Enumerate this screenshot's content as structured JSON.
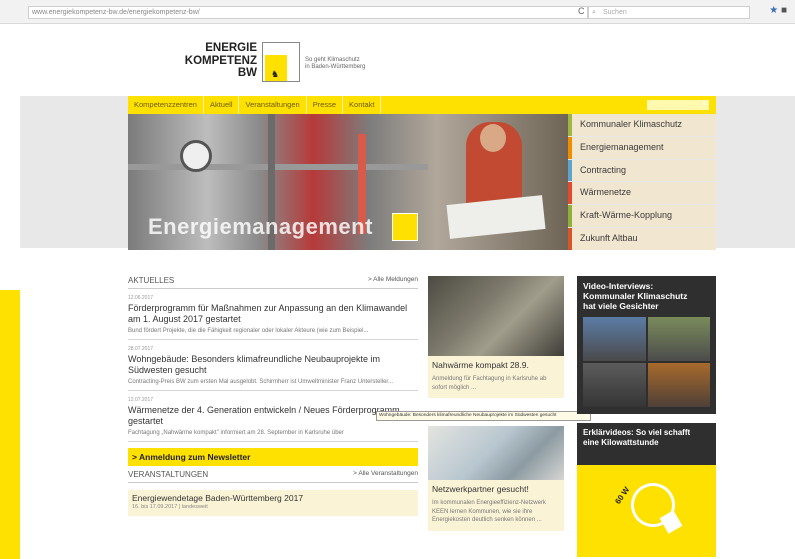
{
  "browser": {
    "url": "www.energiekompetenz-bw.de/energiekompetenz-bw/",
    "search_placeholder": "Suchen"
  },
  "logo": {
    "line1": "ENERGIE",
    "line2": "KOMPETENZ",
    "line3": "BW",
    "slogan_line1": "So geht Klimaschutz",
    "slogan_line2": "in Baden-Württemberg"
  },
  "nav": {
    "items": [
      "Kompetenzzentren",
      "Aktuell",
      "Veranstaltungen",
      "Presse",
      "Kontakt"
    ]
  },
  "hero": {
    "title": "Energiemanagement"
  },
  "topics": [
    "Kommunaler Klimaschutz",
    "Energiemanagement",
    "Contracting",
    "Wärmenetze",
    "Kraft-Wärme-Kopplung",
    "Zukunft Altbau"
  ],
  "aktuelles": {
    "heading": "AKTUELLES",
    "more": "> Alle Meldungen",
    "items": [
      {
        "date": "12.06.2017",
        "title": "Förderprogramm für Maßnahmen zur Anpassung an den Klimawandel am 1. August 2017 gestartet",
        "desc": "Bund fördert Projekte, die die Fähigkeit regionaler oder lokaler Akteure (wie zum Beispiel..."
      },
      {
        "date": "28.07.2017",
        "title": "Wohngebäude: Besonders klimafreundliche Neubauprojekte im Südwesten gesucht",
        "desc": "Contracting-Preis BW zum ersten Mal ausgelobt. Schirmherr ist Umweltminister Franz Untersteller..."
      },
      {
        "date": "12.07.2017",
        "title": "Wärmenetze der 4. Generation entwickeln / Neues Förderprogramm gestartet",
        "desc": "Fachtagung „Nahwärme kompakt\" informiert am 28. September in Karlsruhe über"
      }
    ]
  },
  "newsletter": "> Anmeldung zum Newsletter",
  "veranstaltungen": {
    "heading": "VERANSTALTUNGEN",
    "more": "> Alle Veranstaltungen",
    "items": [
      {
        "title": "Energiewendetage Baden-Württemberg 2017",
        "meta": "16. bis 17.09.2017 | landesweit"
      }
    ]
  },
  "cards": [
    {
      "title": "Nahwärme kompakt 28.9.",
      "desc": "Anmeldung für Fachtagung in Karlsruhe ab sofort möglich ..."
    },
    {
      "title": "Netzwerkpartner gesucht!",
      "desc": "Im kommunalen Energieeffizienz-Netzwerk KEEN lernen Kommunen, wie sie ihre Energiekosten deutlich senken können ..."
    }
  ],
  "tooltip": "Wohngebäude: Besonders klimafreundliche Neubauprojekte im Südwesten gesucht",
  "video": {
    "title_line1": "Video-Interviews:",
    "title_line2": "Kommunaler Klimaschutz",
    "title_line3": "hat viele Gesichter"
  },
  "explainer": {
    "title_line1": "Erklärvideos: So viel schafft",
    "title_line2": "eine Kilowattstunde",
    "bulb_label": "60 W"
  }
}
